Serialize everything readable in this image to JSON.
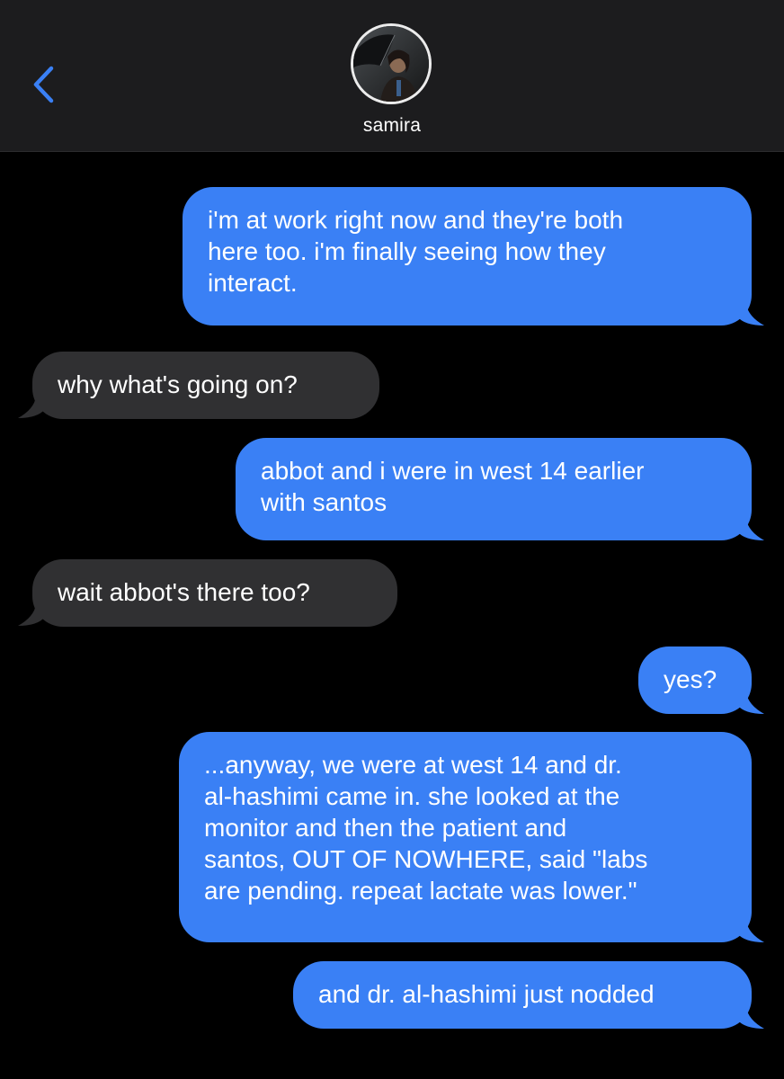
{
  "header": {
    "back_icon": "chevron-left-icon",
    "contact_name": "samira",
    "accent_color": "#3a80f5"
  },
  "messages": [
    {
      "direction": "sent",
      "text": "i'm at work right now and they're both\nhere too. i'm finally seeing how they\ninteract."
    },
    {
      "direction": "received",
      "text": "why what's going on?"
    },
    {
      "direction": "sent",
      "text": "abbot and i were in west 14 earlier\nwith santos"
    },
    {
      "direction": "received",
      "text": "wait abbot's there too?"
    },
    {
      "direction": "sent",
      "text": "yes?"
    },
    {
      "direction": "sent",
      "text": "...anyway, we were at west 14 and dr.\nal-hashimi came in. she looked at the\nmonitor and then the patient and\nsantos, OUT OF NOWHERE, said \"labs\nare pending. repeat lactate was lower.\""
    },
    {
      "direction": "sent",
      "text": "and dr. al-hashimi just nodded"
    }
  ],
  "colors": {
    "sent_bubble": "#3a80f5",
    "received_bubble": "#303032",
    "background": "#000000",
    "header_background": "#1c1c1e"
  }
}
